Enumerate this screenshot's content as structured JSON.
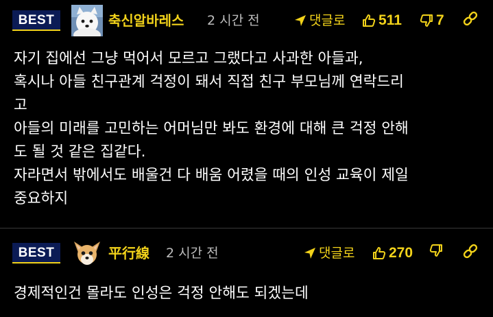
{
  "colors": {
    "background": "#000000",
    "accent": "#f2d21a",
    "badge_background": "#0b1b55",
    "divider": "#3a3a3a",
    "time_text": "#bdbdbd"
  },
  "comments": [
    {
      "badge": "BEST",
      "avatar": "white-dog-avatar",
      "username": "축신알바레스",
      "time": "2 시간 전",
      "reply_label": "댓글로",
      "like_count": "511",
      "dislike_count": "7",
      "body_lines": [
        "자기 집에선 그냥 먹어서 모르고 그랬다고 사과한 아들과,",
        "혹시나 아들 친구관계 걱정이 돼서 직접 친구 부모님께 연락드리",
        "고",
        "아들의 미래를 고민하는 어머님만 봐도 환경에 대해 큰 걱정 안해",
        "도 될 것 같은 집같다.",
        "자라면서 밖에서도 배울건 다 배움 어렸을 때의 인성 교육이 제일",
        "중요하지"
      ]
    },
    {
      "badge": "BEST",
      "avatar": "chihuahua-avatar",
      "username": "平行線",
      "time": "2 시간 전",
      "reply_label": "댓글로",
      "like_count": "270",
      "dislike_count": "",
      "body_lines": [
        "경제적인건 몰라도 인성은 걱정 안해도 되겠는데"
      ]
    }
  ]
}
